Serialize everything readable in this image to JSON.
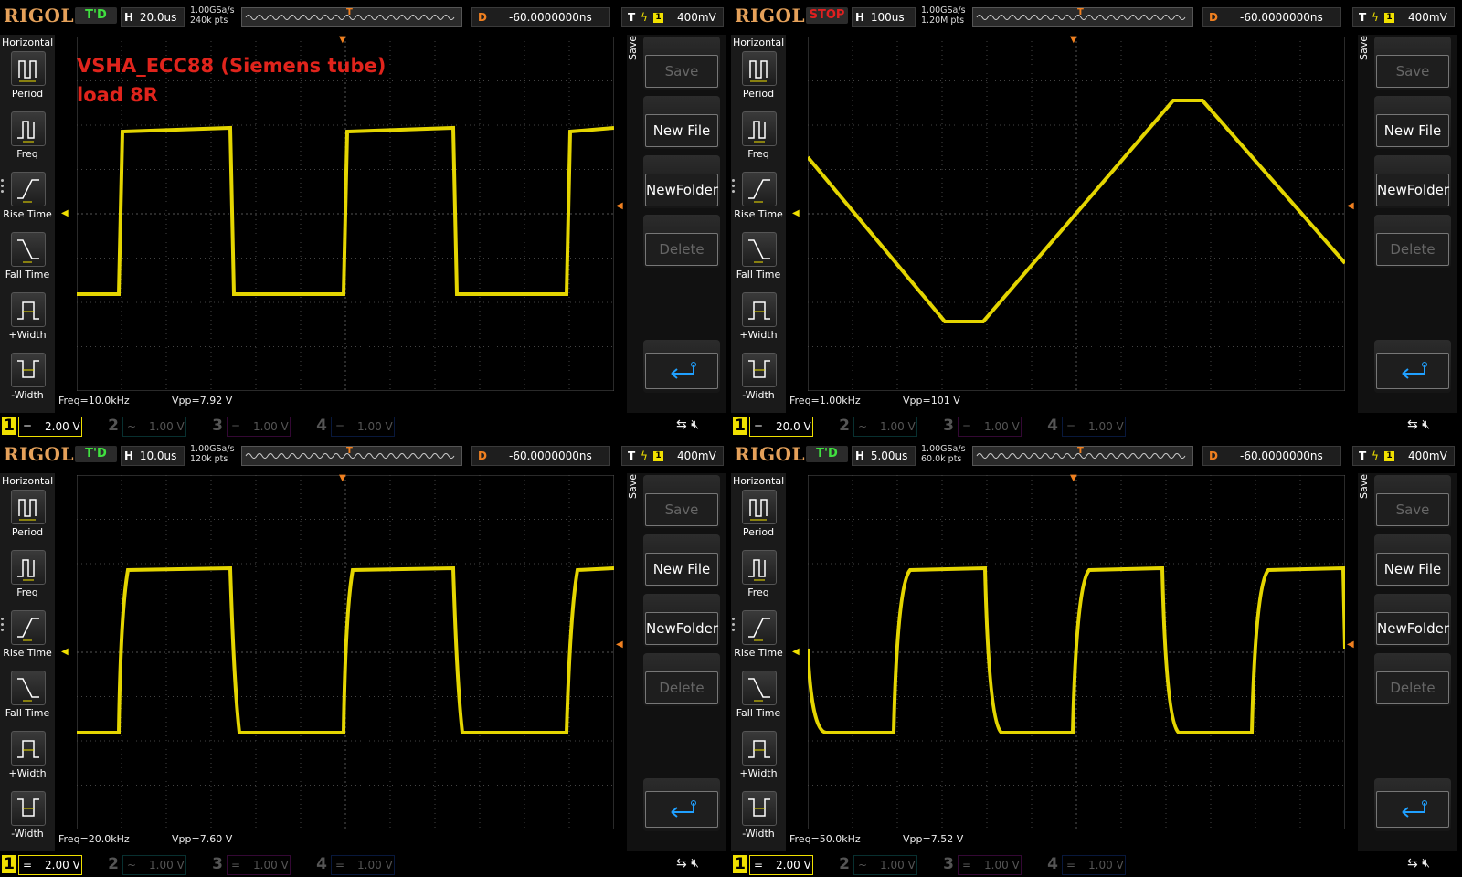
{
  "colors": {
    "trace": "#f0e000",
    "accent": "#f08020",
    "title": "#e0241c",
    "stop": "#e02020",
    "td": "#40e040"
  },
  "panels": [
    {
      "logo": "RIGOL",
      "status": "T'D",
      "status_color": "#40e040",
      "h_label": "H",
      "h_value": "20.0us",
      "rate": "1.00GSa/s",
      "pts": "240k pts",
      "d_label": "D",
      "d_value": "-60.0000000ns",
      "t_label": "T",
      "t_value": "400mV",
      "t_channel": "1",
      "title_line1": "VSHA_ECC88 (Siemens tube)",
      "title_line2": "load 8R",
      "freq": "Freq=10.0kHz",
      "vpp": "Vpp=7.92 V",
      "waveform": "square",
      "ch1": {
        "num": "1",
        "coupling": "=",
        "volts": "2.00 V"
      }
    },
    {
      "logo": "RIGOL",
      "status": "STOP",
      "status_color": "#e02020",
      "h_label": "H",
      "h_value": "100us",
      "rate": "1.00GSa/s",
      "pts": "1.20M pts",
      "d_label": "D",
      "d_value": "-60.0000000ns",
      "t_label": "T",
      "t_value": "400mV",
      "t_channel": "1",
      "title_line1": "",
      "title_line2": "",
      "freq": "Freq=1.00kHz",
      "vpp": "Vpp=101 V",
      "waveform": "triangle",
      "ch1": {
        "num": "1",
        "coupling": "=",
        "volts": "20.0 V"
      }
    },
    {
      "logo": "RIGOL",
      "status": "T'D",
      "status_color": "#40e040",
      "h_label": "H",
      "h_value": "10.0us",
      "rate": "1.00GSa/s",
      "pts": "120k pts",
      "d_label": "D",
      "d_value": "-60.0000000ns",
      "t_label": "T",
      "t_value": "400mV",
      "t_channel": "1",
      "title_line1": "",
      "title_line2": "",
      "freq": "Freq=20.0kHz",
      "vpp": "Vpp=7.60 V",
      "waveform": "square20",
      "ch1": {
        "num": "1",
        "coupling": "=",
        "volts": "2.00 V"
      }
    },
    {
      "logo": "RIGOL",
      "status": "T'D",
      "status_color": "#40e040",
      "h_label": "H",
      "h_value": "5.00us",
      "rate": "1.00GSa/s",
      "pts": "60.0k pts",
      "d_label": "D",
      "d_value": "-60.0000000ns",
      "t_label": "T",
      "t_value": "400mV",
      "t_channel": "1",
      "title_line1": "",
      "title_line2": "",
      "freq": "Freq=50.0kHz",
      "vpp": "Vpp=7.52 V",
      "waveform": "square50",
      "ch1": {
        "num": "1",
        "coupling": "=",
        "volts": "2.00 V"
      }
    }
  ],
  "menu": {
    "title": "Horizontal",
    "items": [
      {
        "label": "Period",
        "icon": "period-icon"
      },
      {
        "label": "Freq",
        "icon": "freq-icon"
      },
      {
        "label": "Rise Time",
        "icon": "rise-time-icon"
      },
      {
        "label": "Fall Time",
        "icon": "fall-time-icon"
      },
      {
        "label": "+Width",
        "icon": "pos-width-icon"
      },
      {
        "label": "-Width",
        "icon": "neg-width-icon"
      }
    ]
  },
  "save_menu": {
    "title": "Save",
    "buttons": [
      {
        "label": "Save",
        "disabled": true
      },
      {
        "label": "New File",
        "disabled": false
      },
      {
        "label": "NewFolder",
        "disabled": false
      },
      {
        "label": "Delete",
        "disabled": true
      }
    ],
    "return_icon": "return-arrow-icon"
  },
  "channels_off": [
    {
      "num": "2",
      "coupling": "~",
      "volts": "1.00 V",
      "color": "#20c0c0"
    },
    {
      "num": "3",
      "coupling": "=",
      "volts": "1.00 V",
      "color": "#d020d0"
    },
    {
      "num": "4",
      "coupling": "=",
      "volts": "1.00 V",
      "color": "#2060f0"
    }
  ],
  "icons": {
    "usb": "usb-icon",
    "mute": "speaker-mute-icon",
    "trigger_marker": "trigger-position-marker",
    "ch1_marker": "ch1-level-marker",
    "trig_level": "trigger-level-marker"
  }
}
